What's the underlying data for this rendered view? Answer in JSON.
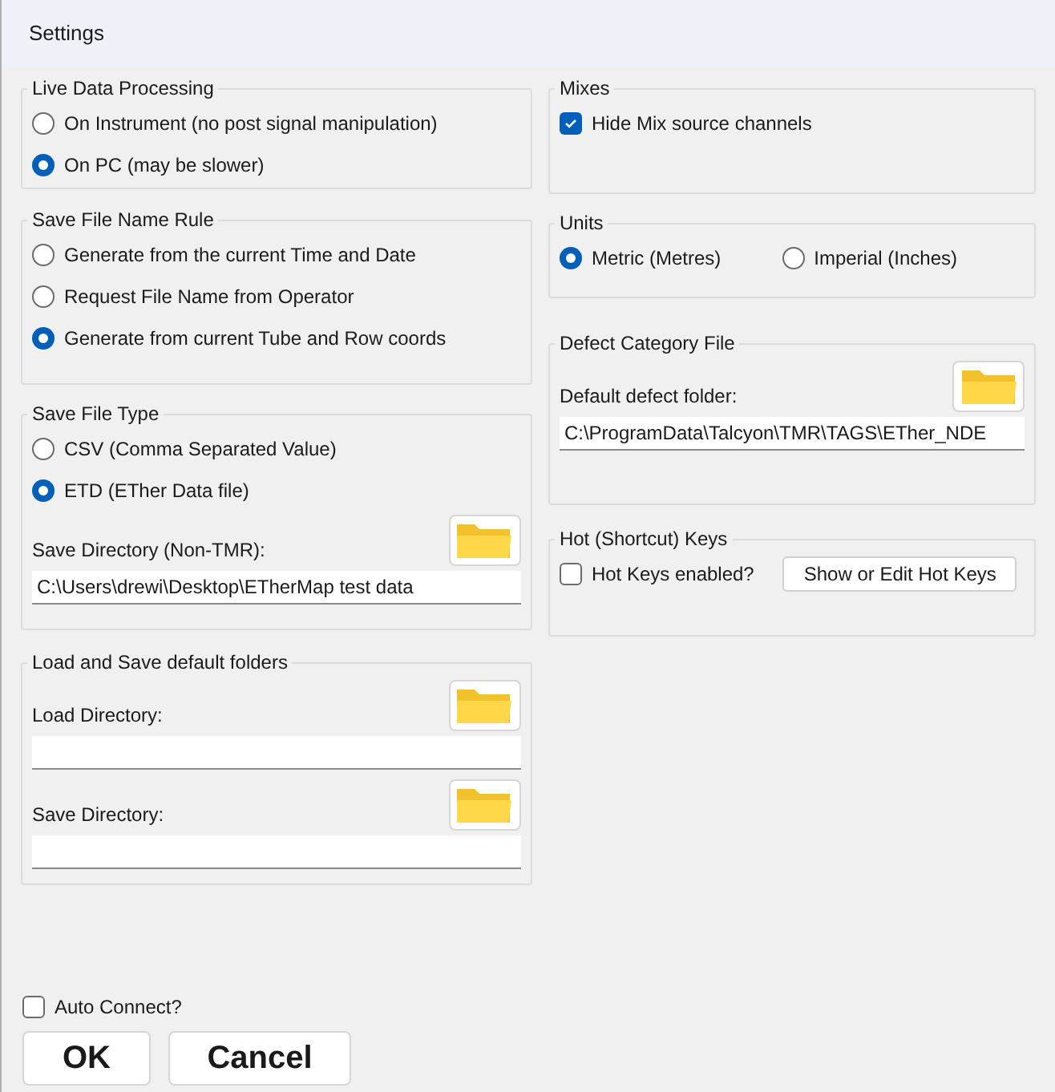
{
  "window": {
    "title": "Settings"
  },
  "columns": [
    {
      "groups": [
        {
          "title": "Live Data Processing",
          "items": [
            {
              "kind": "radio",
              "label": "On Instrument (no post signal manipulation)",
              "selected": false
            },
            {
              "kind": "radio",
              "label": "On PC (may be slower)",
              "selected": true
            }
          ]
        },
        {
          "title": "Save File Name Rule",
          "items": [
            {
              "kind": "radio",
              "label": "Generate from the current Time and Date",
              "selected": false
            },
            {
              "kind": "radio",
              "label": "Request File Name from Operator",
              "selected": false
            },
            {
              "kind": "radio",
              "label": "Generate from current Tube and Row coords",
              "selected": true
            }
          ]
        },
        {
          "title": "Save File Type",
          "items": [
            {
              "kind": "radio",
              "label": "CSV (Comma Separated Value)",
              "selected": false
            },
            {
              "kind": "radio",
              "label": "ETD (ETher Data file)",
              "selected": true
            },
            {
              "kind": "path_field",
              "label": "Save Directory (Non-TMR):",
              "value": "C:\\Users\\drewi\\Desktop\\ETherMap test data"
            }
          ]
        },
        {
          "title": "Load and Save default folders",
          "items": [
            {
              "kind": "path_field",
              "label": "Load Directory:"
            },
            {
              "kind": "path_field",
              "label": "Save Directory:"
            }
          ]
        }
      ]
    },
    {
      "groups": [
        {
          "title": "Mixes",
          "items": [
            {
              "kind": "checkbox",
              "label": "Hide Mix source channels",
              "checked": true
            }
          ]
        },
        {
          "title": "Units",
          "items": [
            {
              "kind": "radio",
              "label": "Metric (Metres)",
              "selected": true
            },
            {
              "kind": "radio",
              "label": "Imperial (Inches)",
              "selected": false
            }
          ]
        },
        {
          "title": "Defect Category File",
          "items": [
            {
              "kind": "path_field",
              "label": "Default defect folder:",
              "value": "C:\\ProgramData\\Talcyon\\TMR\\TAGS\\ETher_NDE"
            }
          ]
        },
        {
          "title": "Hot (Shortcut) Keys",
          "items": [
            {
              "kind": "checkbox",
              "label": "Hot Keys enabled?",
              "checked": false
            },
            {
              "kind": "button",
              "label": "Show or Edit Hot Keys"
            }
          ]
        }
      ]
    }
  ],
  "auto_connect": {
    "label": "Auto Connect?",
    "checked": false
  },
  "buttons": [
    "OK",
    "Cancel"
  ]
}
